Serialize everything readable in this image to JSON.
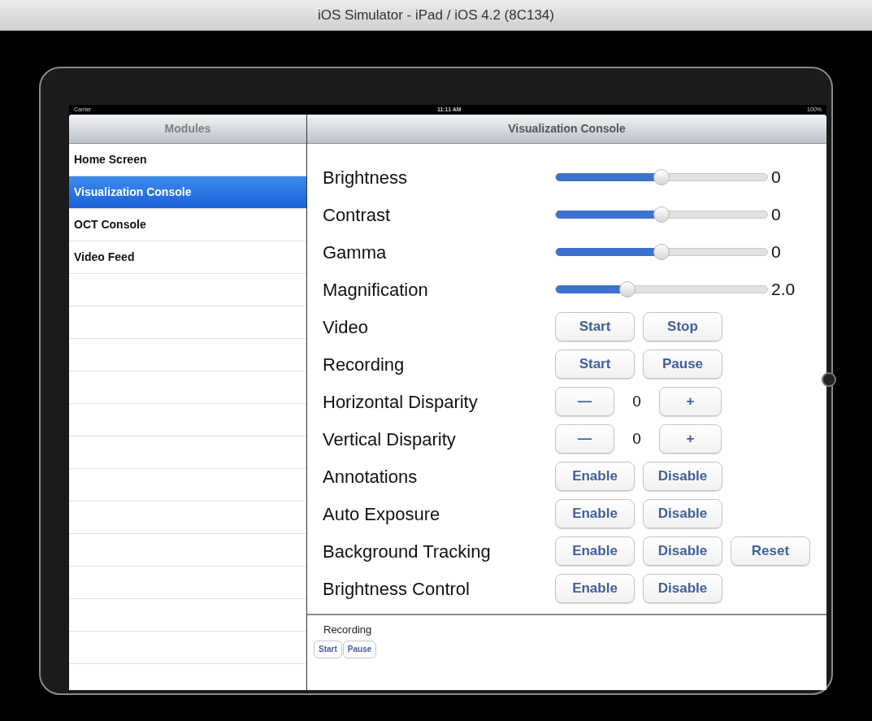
{
  "window": {
    "title": "iOS Simulator - iPad / iOS 4.2 (8C134)"
  },
  "status_bar": {
    "carrier": "Carrier",
    "time": "11:11 AM",
    "battery": "100%"
  },
  "sidebar": {
    "title": "Modules",
    "items": [
      {
        "label": "Home Screen",
        "selected": false
      },
      {
        "label": "Visualization Console",
        "selected": true
      },
      {
        "label": "OCT Console",
        "selected": false
      },
      {
        "label": "Video Feed",
        "selected": false
      }
    ]
  },
  "detail": {
    "title": "Visualization Console",
    "rows": [
      {
        "kind": "slider",
        "label": "Brightness",
        "level": 0.5,
        "reading": "0"
      },
      {
        "kind": "slider",
        "label": "Contrast",
        "level": 0.5,
        "reading": "0"
      },
      {
        "kind": "slider",
        "label": "Gamma",
        "level": 0.5,
        "reading": "0"
      },
      {
        "kind": "slider",
        "label": "Magnification",
        "level": 0.34,
        "reading": "2.0"
      },
      {
        "kind": "buttons",
        "label": "Video",
        "buttons": [
          "Start",
          "Stop"
        ]
      },
      {
        "kind": "buttons",
        "label": "Recording",
        "buttons": [
          "Start",
          "Pause"
        ]
      },
      {
        "kind": "stepper",
        "label": "Horizontal Disparity",
        "minus": "—",
        "value": "0",
        "plus": "+"
      },
      {
        "kind": "stepper",
        "label": "Vertical Disparity",
        "minus": "—",
        "value": "0",
        "plus": "+"
      },
      {
        "kind": "buttons",
        "label": "Annotations",
        "buttons": [
          "Enable",
          "Disable"
        ]
      },
      {
        "kind": "buttons",
        "label": "Auto Exposure",
        "buttons": [
          "Enable",
          "Disable"
        ]
      },
      {
        "kind": "buttons",
        "label": "Background Tracking",
        "buttons": [
          "Enable",
          "Disable",
          "Reset"
        ]
      },
      {
        "kind": "buttons",
        "label": "Brightness Control",
        "buttons": [
          "Enable",
          "Disable"
        ]
      }
    ],
    "footer": {
      "label": "Recording",
      "buttons": [
        "Start",
        "Pause"
      ]
    }
  }
}
